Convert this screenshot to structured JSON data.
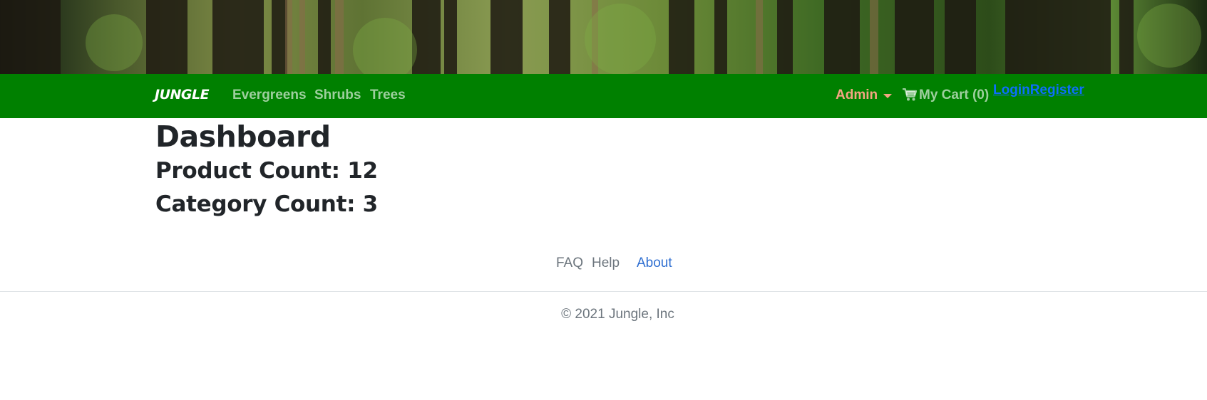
{
  "navbar": {
    "brand": "JUNGLE",
    "links": [
      "Evergreens",
      "Shrubs",
      "Trees"
    ],
    "admin_label": "Admin",
    "cart_label": "My Cart (0)",
    "login_label": "Login",
    "register_label": "Register"
  },
  "main": {
    "title": "Dashboard",
    "product_count": "Product Count: 12",
    "category_count": "Category Count: 3"
  },
  "footer": {
    "links": [
      "FAQ",
      "Help",
      "About"
    ],
    "copyright": "© 2021 Jungle, Inc"
  },
  "colors": {
    "navbar_bg": "#008000",
    "admin_accent": "#f4a582",
    "link_blue": "#0d6efd"
  },
  "icons": [
    "cart-icon",
    "caret-down-icon"
  ]
}
